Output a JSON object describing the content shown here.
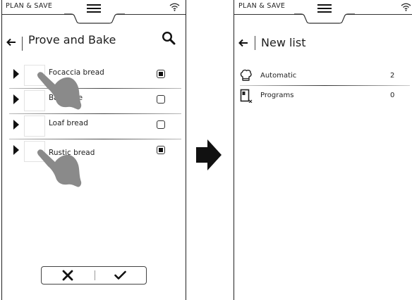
{
  "left_screen": {
    "brand": "PLAN & SAVE",
    "title": "Prove and Bake",
    "rows": [
      {
        "label": "Focaccia bread",
        "checked": true
      },
      {
        "label": "Baguette",
        "checked": false
      },
      {
        "label": "Loaf bread",
        "checked": false
      },
      {
        "label": "Rustic bread",
        "checked": true
      }
    ],
    "cancel_glyph": "✕",
    "confirm_glyph": "✓"
  },
  "right_screen": {
    "brand": "PLAN & SAVE",
    "title": "New list",
    "rows": [
      {
        "label": "Automatic",
        "count": "2",
        "icon": "chef-hat-icon"
      },
      {
        "label": "Programs",
        "count": "0",
        "icon": "program-icon"
      }
    ]
  },
  "icons": {
    "back": "arrow-left-icon",
    "menu": "hamburger-menu-icon",
    "wifi": "wifi-icon",
    "search": "search-icon",
    "hand": "pointing-hand-icon",
    "transition": "arrow-right-icon"
  },
  "colors": {
    "ink": "#1e1e1e",
    "hand": "#8a8a8a"
  }
}
